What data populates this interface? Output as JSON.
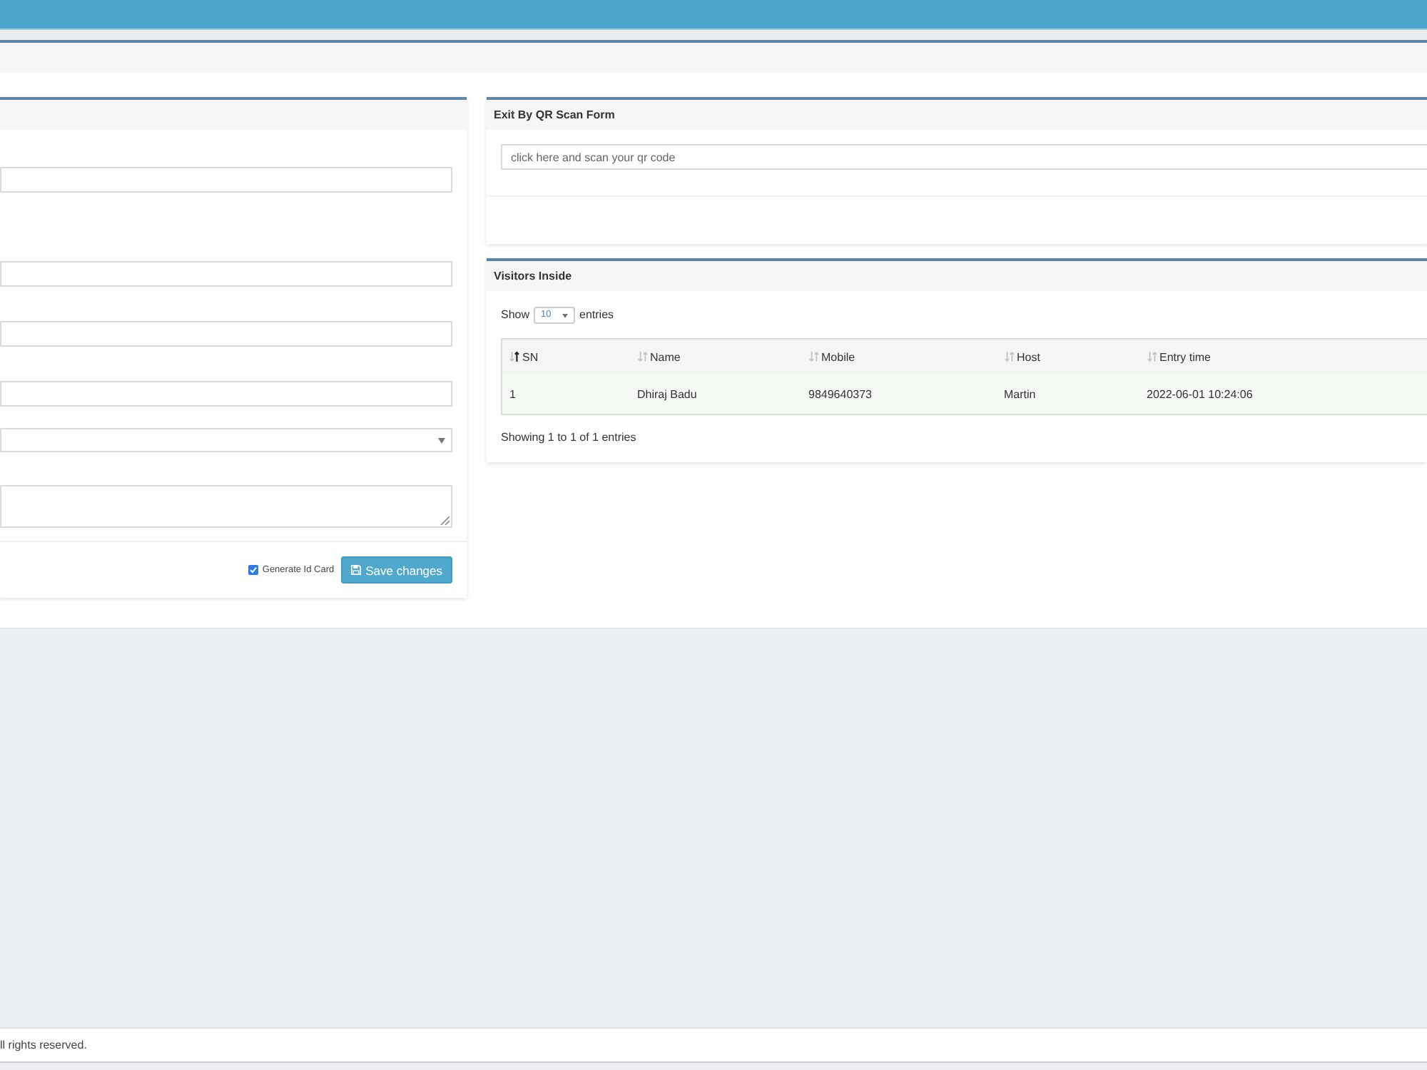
{
  "left_form": {
    "fields": [
      {
        "kind": "text"
      },
      {
        "kind": "text"
      },
      {
        "kind": "text"
      },
      {
        "kind": "text"
      },
      {
        "kind": "select"
      },
      {
        "kind": "textarea"
      }
    ],
    "generate_id_card": {
      "label": "Generate Id Card",
      "checked": true
    },
    "save_button": {
      "label": "Save changes"
    }
  },
  "qr_exit_panel": {
    "title": "Exit By QR Scan Form",
    "scan_field": {
      "placeholder": "click here and scan your qr code"
    }
  },
  "visitors_panel": {
    "title": "Visitors Inside",
    "length_menu": {
      "before": "Show",
      "value": "10",
      "after": "entries"
    },
    "table": {
      "columns": [
        {
          "label": "SN",
          "sorted": true
        },
        {
          "label": "Name",
          "sorted": false
        },
        {
          "label": "Mobile",
          "sorted": false
        },
        {
          "label": "Host",
          "sorted": false
        },
        {
          "label": "Entry time",
          "sorted": false
        }
      ],
      "rows": [
        {
          "cells": [
            "1",
            "Dhiraj Badu",
            "9849640373",
            "Martin",
            "2022-06-01 10:24:06"
          ]
        }
      ]
    },
    "info": "Showing 1 to 1 of 1 entries"
  },
  "footer": {
    "text": "ll rights reserved."
  }
}
